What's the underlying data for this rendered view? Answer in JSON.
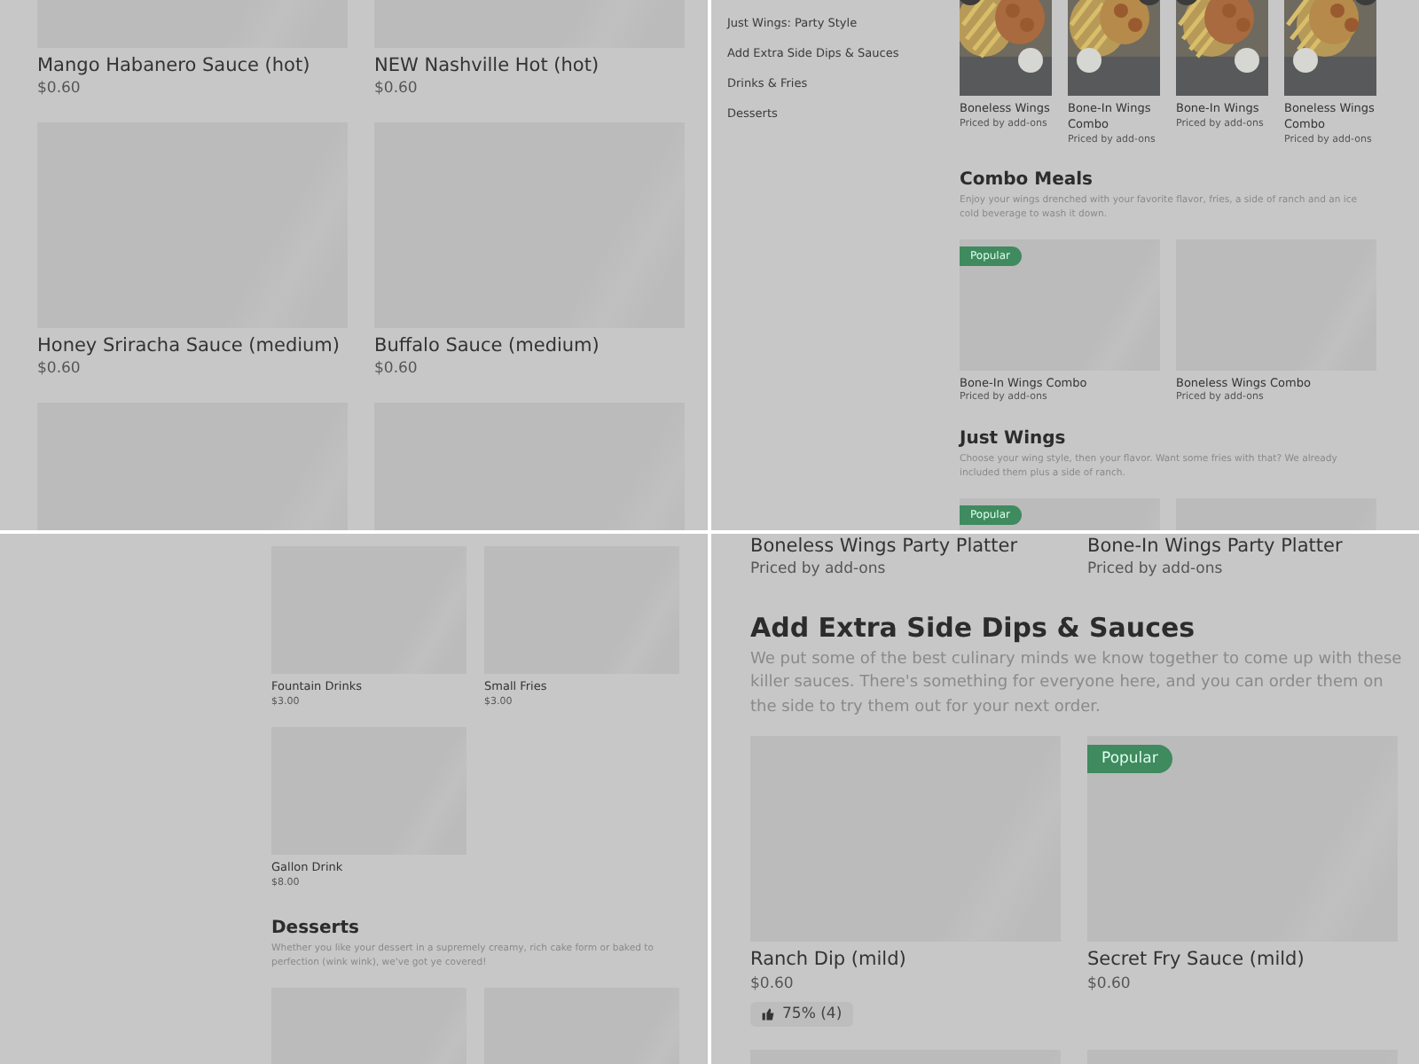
{
  "panels": [
    {
      "kind": "wide-grid",
      "sections": [
        {
          "kind": "two",
          "items": [
            {
              "name": "Mango Habanero Sauce (hot)",
              "price": "$0.60",
              "image": {
                "kind": "placeholder"
              }
            },
            {
              "name": "NEW Nashville Hot (hot)",
              "price": "$0.60",
              "image": {
                "kind": "placeholder"
              }
            },
            {
              "name": "Honey Sriracha Sauce (medium)",
              "price": "$0.60",
              "image": {
                "kind": "placeholder"
              }
            },
            {
              "name": "Buffalo Sauce (medium)",
              "price": "$0.60",
              "image": {
                "kind": "placeholder"
              }
            },
            {
              "image": {
                "kind": "placeholder"
              }
            },
            {
              "image": {
                "kind": "placeholder"
              }
            }
          ]
        }
      ]
    },
    {
      "kind": "sidebar-menu",
      "sidebar": [
        "Just Wings: Party Style",
        "Add Extra Side Dips & Sauces",
        "Drinks & Fries",
        "Desserts"
      ],
      "sections": [
        {
          "kind": "four",
          "items": [
            {
              "name": "Boneless Wings",
              "price": "Priced by add-ons"
            },
            {
              "name": "Bone-In Wings Combo",
              "price": "Priced by add-ons"
            },
            {
              "name": "Bone-In Wings",
              "price": "Priced by add-ons"
            },
            {
              "name": "Boneless Wings Combo",
              "price": "Priced by add-ons"
            }
          ]
        },
        {
          "kind": "two",
          "heading": "Combo Meals",
          "description": "Enjoy your wings drenched with your favorite flavor, fries, a side of ranch and an ice cold beverage to wash it down.",
          "items": [
            {
              "name": "Bone-In Wings Combo",
              "price": "Priced by add-ons",
              "badge": "Popular",
              "image": {
                "kind": "placeholder"
              }
            },
            {
              "name": "Boneless Wings Combo",
              "price": "Priced by add-ons",
              "image": {
                "kind": "placeholder"
              }
            }
          ]
        },
        {
          "kind": "two",
          "heading": "Just Wings",
          "description": "Choose your wing style, then your flavor. Want some fries with that? We already included them plus a side of ranch.",
          "items": [
            {
              "badge": "Popular",
              "image": {
                "kind": "placeholder"
              }
            },
            {
              "image": {
                "kind": "placeholder"
              }
            }
          ]
        }
      ]
    },
    {
      "kind": "narrow-grid",
      "sections": [
        {
          "kind": "two",
          "items": [
            {
              "name": "Fountain Drinks",
              "price": "$3.00",
              "image": {
                "kind": "placeholder"
              }
            },
            {
              "name": "Small Fries",
              "price": "$3.00",
              "image": {
                "kind": "placeholder"
              }
            },
            {
              "name": "Gallon Drink",
              "price": "$8.00",
              "image": {
                "kind": "placeholder"
              }
            }
          ]
        },
        {
          "kind": "two",
          "heading": "Desserts",
          "description": "Whether you like your dessert in a supremely creamy, rich cake form or baked to perfection (wink wink), we've got ye covered!",
          "items": [
            {
              "image": {
                "kind": "placeholder"
              }
            },
            {
              "image": {
                "kind": "placeholder"
              }
            }
          ]
        }
      ]
    },
    {
      "kind": "wide-list",
      "sections": [
        {
          "kind": "two",
          "items": [
            {
              "name": "Boneless Wings Party Platter",
              "price": "Priced by add-ons"
            },
            {
              "name": "Bone-In Wings Party Platter",
              "price": "Priced by add-ons"
            }
          ]
        },
        {
          "kind": "two",
          "heading": "Add Extra Side Dips & Sauces",
          "description": "We put some of the best culinary minds we know together to come up with these killer sauces. There's something for everyone here, and you can order them on the side to try them out for your next order.",
          "items": [
            {
              "name": "Ranch Dip (mild)",
              "price": "$0.60",
              "rating": "75% (4)",
              "image": {
                "kind": "placeholder"
              }
            },
            {
              "name": "Secret Fry Sauce (mild)",
              "price": "$0.60",
              "badge": "Popular",
              "image": {
                "kind": "placeholder"
              }
            },
            {
              "image": {
                "kind": "placeholder"
              }
            },
            {
              "image": {
                "kind": "placeholder"
              }
            }
          ]
        }
      ]
    }
  ]
}
